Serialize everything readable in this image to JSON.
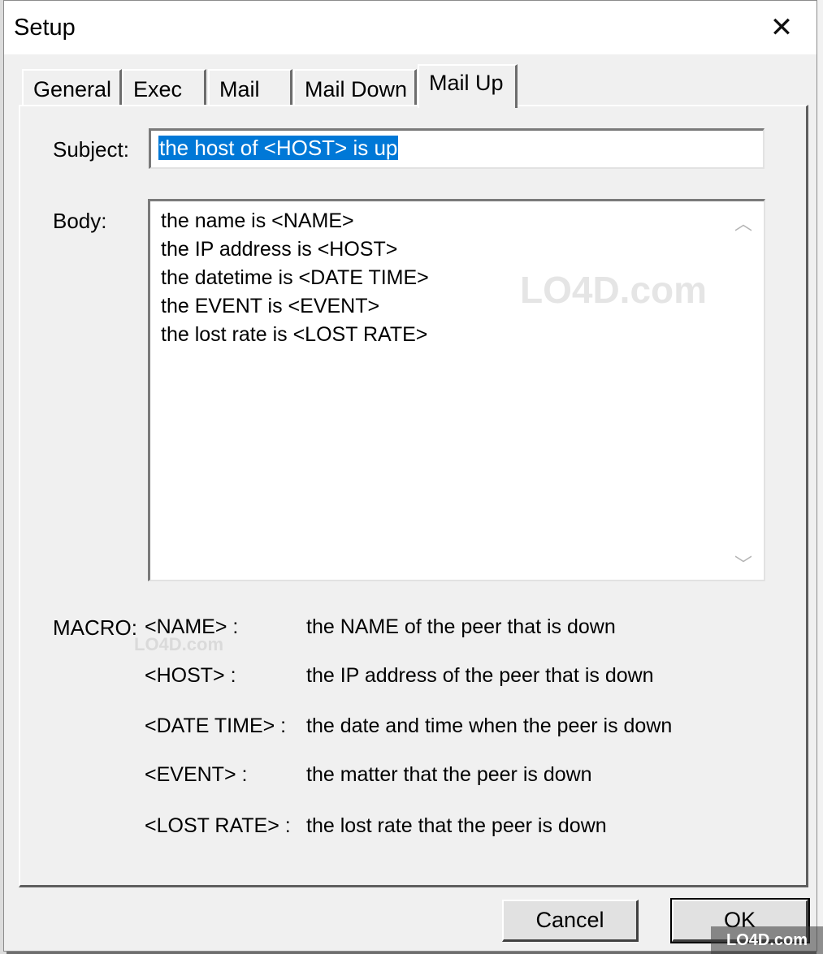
{
  "window": {
    "title": "Setup",
    "close_glyph": "✕"
  },
  "tabs": [
    {
      "label": "General",
      "active": false
    },
    {
      "label": "Exec",
      "active": false
    },
    {
      "label": "Mail",
      "active": false
    },
    {
      "label": "Mail Down",
      "active": false
    },
    {
      "label": "Mail Up",
      "active": true
    }
  ],
  "form": {
    "subject_label": "Subject:",
    "subject_value": "the host of <HOST> is up",
    "body_label": "Body:",
    "body_lines": [
      "the name is <NAME>",
      "the IP address is <HOST>",
      "the datetime is <DATE TIME>",
      "the EVENT is <EVENT>",
      "the lost rate is <LOST RATE>"
    ]
  },
  "macros": {
    "label": "MACRO:",
    "items": [
      {
        "key": "<NAME> :",
        "desc": "the NAME of the peer that is down"
      },
      {
        "key": "<HOST> :",
        "desc": "the IP address of the peer that is down"
      },
      {
        "key": "<DATE TIME> :",
        "desc": "the date and time when the peer is down"
      },
      {
        "key": "<EVENT> :",
        "desc": "the matter that the peer is down"
      },
      {
        "key": "<LOST RATE> :",
        "desc": "the lost rate that the peer is down"
      }
    ]
  },
  "buttons": {
    "cancel": "Cancel",
    "ok": "OK"
  },
  "scrollbar": {
    "up_glyph": "︿",
    "down_glyph": "﹀"
  },
  "watermark": {
    "text": "LO4D.com"
  },
  "icons": {
    "close": "close-icon",
    "scroll_up": "chevron-up-icon",
    "scroll_down": "chevron-down-icon"
  }
}
